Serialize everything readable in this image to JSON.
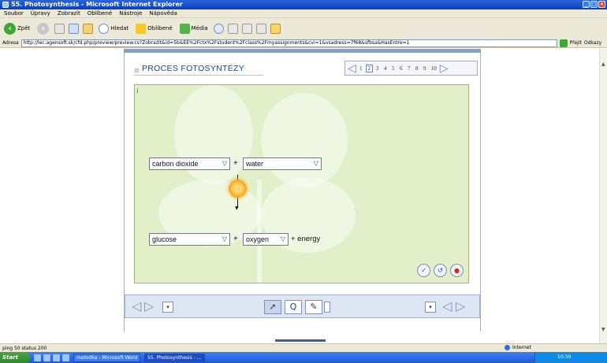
{
  "window": {
    "title": "55. Photosynthesis - Microsoft Internet Explorer"
  },
  "menu": [
    "Soubor",
    "Úpravy",
    "Zobrazit",
    "Oblíbené",
    "Nástroje",
    "Nápověda"
  ],
  "toolbar": {
    "back_label": "Zpět",
    "search_label": "Hledat",
    "favorites_label": "Oblíbené",
    "media_label": "Média"
  },
  "address": {
    "label": "Adresa",
    "url": "http://lec.agensoft.sk/cfd.php/preview/preview.cs?Zobrazit&id=5b&EE%2Fctx%2Fstudent%2Fclass%2Fmyassignments&cvi=1&vsadress=7f68&sfbsa&HasEntre=1",
    "go_label": "Přejít",
    "links_label": "Odkazy"
  },
  "module": {
    "title": "PROCES FOTOSYNTÉZY",
    "pages": [
      "1",
      "2",
      "3",
      "4",
      "5",
      "6",
      "7",
      "8",
      "9",
      "10"
    ],
    "current_page": "2",
    "info_label": "i"
  },
  "equation": {
    "reactant1": "carbon dioxide",
    "reactant2": "water",
    "product1": "glucose",
    "product2": "oxygen",
    "plus": "+",
    "energy": "+ energy"
  },
  "status": {
    "text": "ping 50 status 200",
    "zone": "Internet"
  },
  "taskbar": {
    "start": "Start",
    "tasks": [
      "metodka - Microsoft Word",
      "55. Photosynthesis - ..."
    ],
    "clock": "10:39"
  }
}
